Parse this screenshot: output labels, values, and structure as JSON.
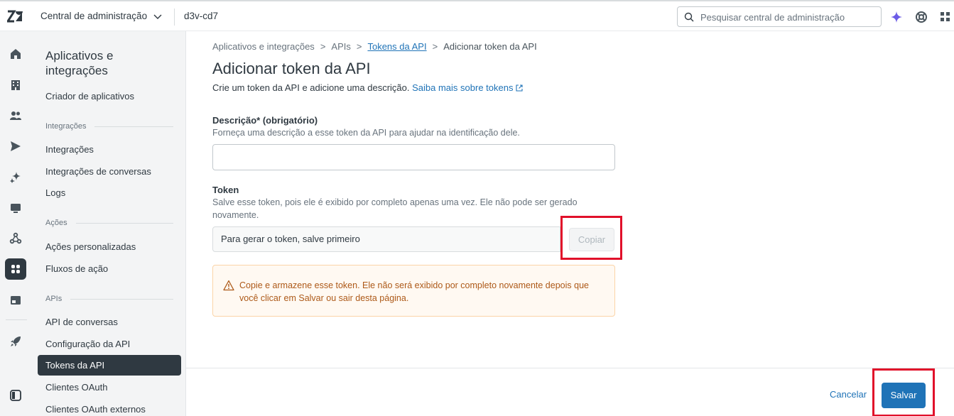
{
  "topbar": {
    "product": "Central de administração",
    "subdomain": "d3v-cd7",
    "search_placeholder": "Pesquisar central de administração"
  },
  "subnav": {
    "title": "Aplicativos e integrações",
    "apps_builder": "Criador de aplicativos",
    "group_integrations": "Integrações",
    "integrations": "Integrações",
    "conversation_integrations": "Integrações de conversas",
    "logs": "Logs",
    "group_actions": "Ações",
    "custom_actions": "Ações personalizadas",
    "action_flows": "Fluxos de ação",
    "group_apis": "APIs",
    "conversations_api": "API de conversas",
    "api_config": "Configuração da API",
    "api_tokens": "Tokens da API",
    "oauth_clients": "Clientes OAuth",
    "external_oauth_clients": "Clientes OAuth externos"
  },
  "breadcrumb": {
    "c1": "Aplicativos e integrações",
    "c2": "APIs",
    "c3": "Tokens da API",
    "c4": "Adicionar token da API",
    "sep": ">"
  },
  "page": {
    "title": "Adicionar token da API",
    "intro": "Crie um token da API e adicione uma descrição.",
    "learn_more": "Saiba mais sobre tokens"
  },
  "form": {
    "description_label": "Descrição* (obrigatório)",
    "description_hint": "Forneça uma descrição a esse token da API para ajudar na identificação dele.",
    "description_value": "",
    "token_label": "Token",
    "token_hint": "Salve esse token, pois ele é exibido por completo apenas uma vez. Ele não pode ser gerado novamente.",
    "token_value": "Para gerar o token, salve primeiro",
    "copy_label": "Copiar"
  },
  "alert": {
    "text": "Copie e armazene esse token. Ele não será exibido por completo novamente depois que você clicar em Salvar ou sair desta página."
  },
  "footer": {
    "cancel_label": "Cancelar",
    "save_label": "Salvar"
  },
  "colors": {
    "accent": "#1f73b7",
    "highlight": "#e1102a",
    "sidebar_active": "#2f3941",
    "alert_bg": "#fff9f2",
    "alert_text": "#ad5918"
  }
}
